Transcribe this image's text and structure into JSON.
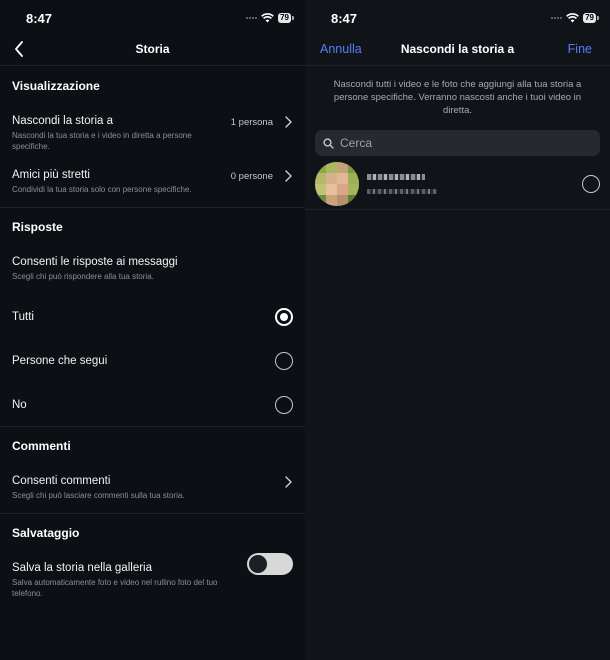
{
  "left": {
    "status": {
      "time": "8:47",
      "battery": "79"
    },
    "header": {
      "title": "Storia"
    },
    "visualizzazione": {
      "title": "Visualizzazione",
      "hide": {
        "title": "Nascondi la storia a",
        "sub": "Nascondi la tua storia e i video in diretta a persone specifiche.",
        "value": "1 persona"
      },
      "close_friends": {
        "title": "Amici più stretti",
        "sub": "Condividi la tua storia solo con persone specifiche.",
        "value": "0 persone"
      }
    },
    "risposte": {
      "title": "Risposte",
      "allow": {
        "title": "Consenti le risposte ai messaggi",
        "sub": "Scegli chi può rispondere alla tua storia."
      },
      "options": [
        "Tutti",
        "Persone che segui",
        "No"
      ],
      "selected": "Tutti"
    },
    "commenti": {
      "title": "Commenti",
      "allow": {
        "title": "Consenti commenti",
        "sub": "Scegli chi può lasciare commenti sulla tua storia."
      }
    },
    "salvataggio": {
      "title": "Salvataggio",
      "save": {
        "title": "Salva la storia nella galleria",
        "sub": "Salva automaticamente foto e video nel rullino foto del tuo telefono.",
        "enabled": false
      }
    }
  },
  "right": {
    "status": {
      "time": "8:47",
      "battery": "79"
    },
    "header": {
      "cancel": "Annulla",
      "title": "Nascondi la storia a",
      "done": "Fine"
    },
    "description": "Nascondi tutti i video e le foto che aggiungi alla tua storia a persone specifiche. Verranno nascosti anche i tuoi video in diretta.",
    "search": {
      "placeholder": "Cerca"
    }
  },
  "colors": {
    "accent": "#5b7cf0",
    "background": "#0c1014",
    "subtext": "#8e8e93"
  }
}
